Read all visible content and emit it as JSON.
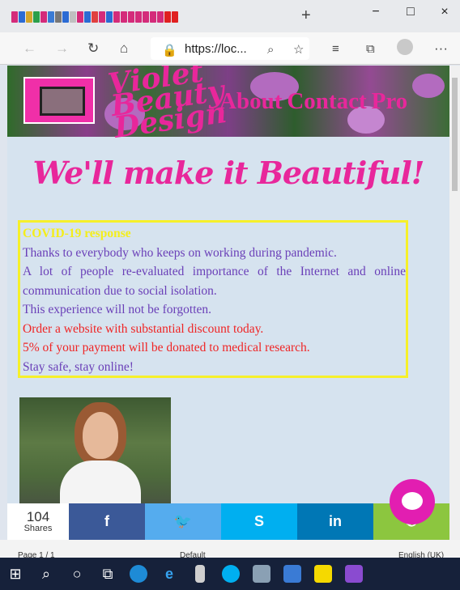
{
  "browser": {
    "url": "https://loc...",
    "newtab": "+",
    "minimize": "−",
    "maximize": "□",
    "close": "×"
  },
  "site": {
    "logo": "Violet Beauty Design",
    "menu": [
      "About",
      "Contact",
      "Pro"
    ],
    "slogan": "We'll make it Beautiful!",
    "covid": {
      "heading": "COVID-19 response",
      "lines": [
        "Thanks to everybody who keeps on working during pandemic.",
        "A lot of people re-evaluated importance of the Internet and online communication due to social isolation.",
        "This experience will not be forgotten."
      ],
      "red_lines": [
        "Order a website with substantial discount today.",
        "5% of your payment will be donated to medical research."
      ],
      "closing": "Stay safe, stay online!"
    }
  },
  "share": {
    "count": "104",
    "label": "Shares",
    "buttons": [
      "f",
      "🐦",
      "S",
      "in",
      "✆"
    ],
    "colors": [
      "#3b5998",
      "#55acee",
      "#00aff0",
      "#0077b5",
      "#8cc63f"
    ]
  },
  "status": {
    "left": "Page 1 / 1",
    "mid": "Default",
    "right": "English (UK)"
  }
}
